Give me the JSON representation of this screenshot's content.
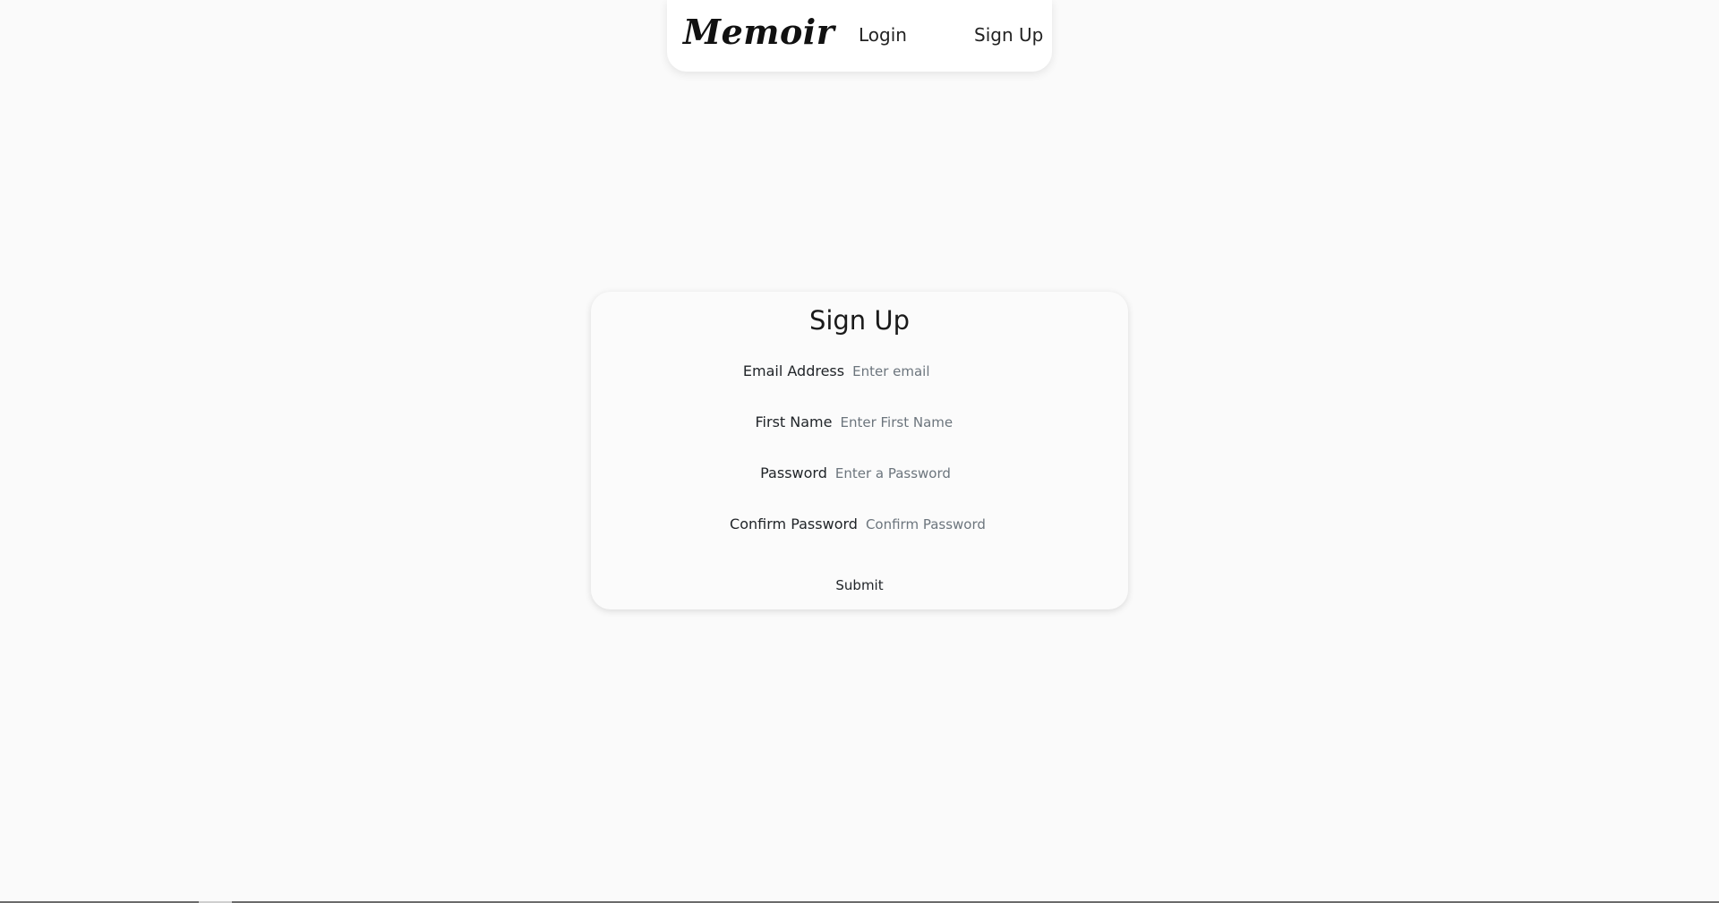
{
  "navbar": {
    "brand": "Memoir",
    "links": [
      {
        "label": "Login"
      },
      {
        "label": "Sign Up"
      }
    ]
  },
  "signup_form": {
    "title": "Sign Up",
    "fields": [
      {
        "label": "Email Address",
        "placeholder": "Enter email",
        "value": ""
      },
      {
        "label": "First Name",
        "placeholder": "Enter First Name",
        "value": ""
      },
      {
        "label": "Password",
        "placeholder": "Enter a Password",
        "value": ""
      },
      {
        "label": "Confirm Password",
        "placeholder": "Confirm Password",
        "value": ""
      }
    ],
    "submit_label": "Submit"
  },
  "colors": {
    "page_background": "#fafafa",
    "card_background": "#fbfbfb",
    "text": "#212529",
    "placeholder": "#6c757d"
  }
}
